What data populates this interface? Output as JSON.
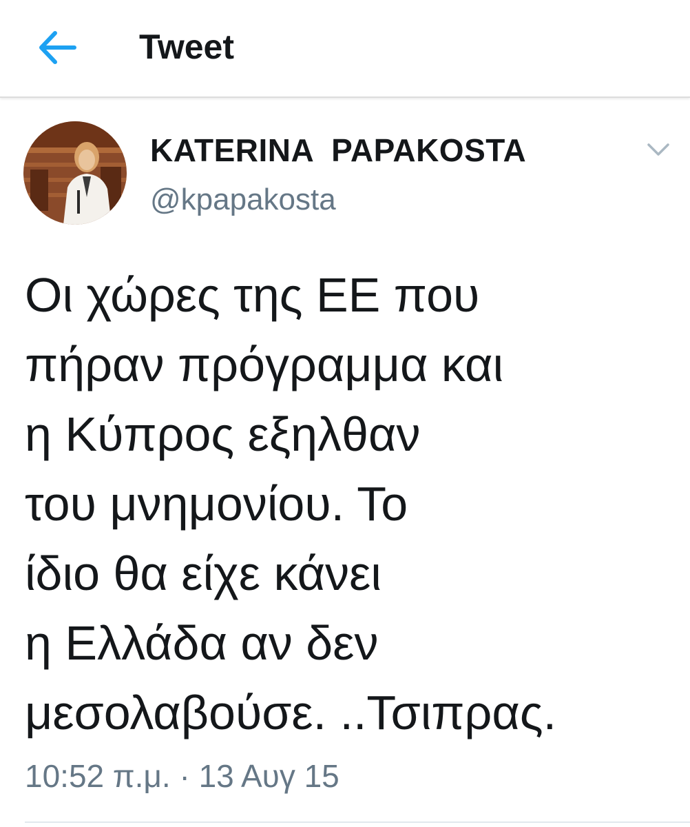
{
  "header": {
    "title": "Tweet",
    "back_icon": "arrow-left-icon",
    "accent_color": "#1da1f2"
  },
  "tweet": {
    "author": {
      "display_name": "KATERINA  PAPAKOSTA",
      "handle": "@kpapakosta",
      "avatar_icon": "profile-photo"
    },
    "menu_icon": "chevron-down-icon",
    "text_lines": [
      "Οι χώρες της ΕΕ που",
      "πήραν πρόγραμμα και",
      "η Κύπρος εξηλθαν",
      "του μνημονίου. Το",
      "ίδιο θα είχε κάνει",
      "η Ελλάδα αν δεν",
      "μεσολαβούσε. ..Τσιπρας."
    ],
    "timestamp": "10:52 π.μ. · 13 Αυγ 15"
  }
}
